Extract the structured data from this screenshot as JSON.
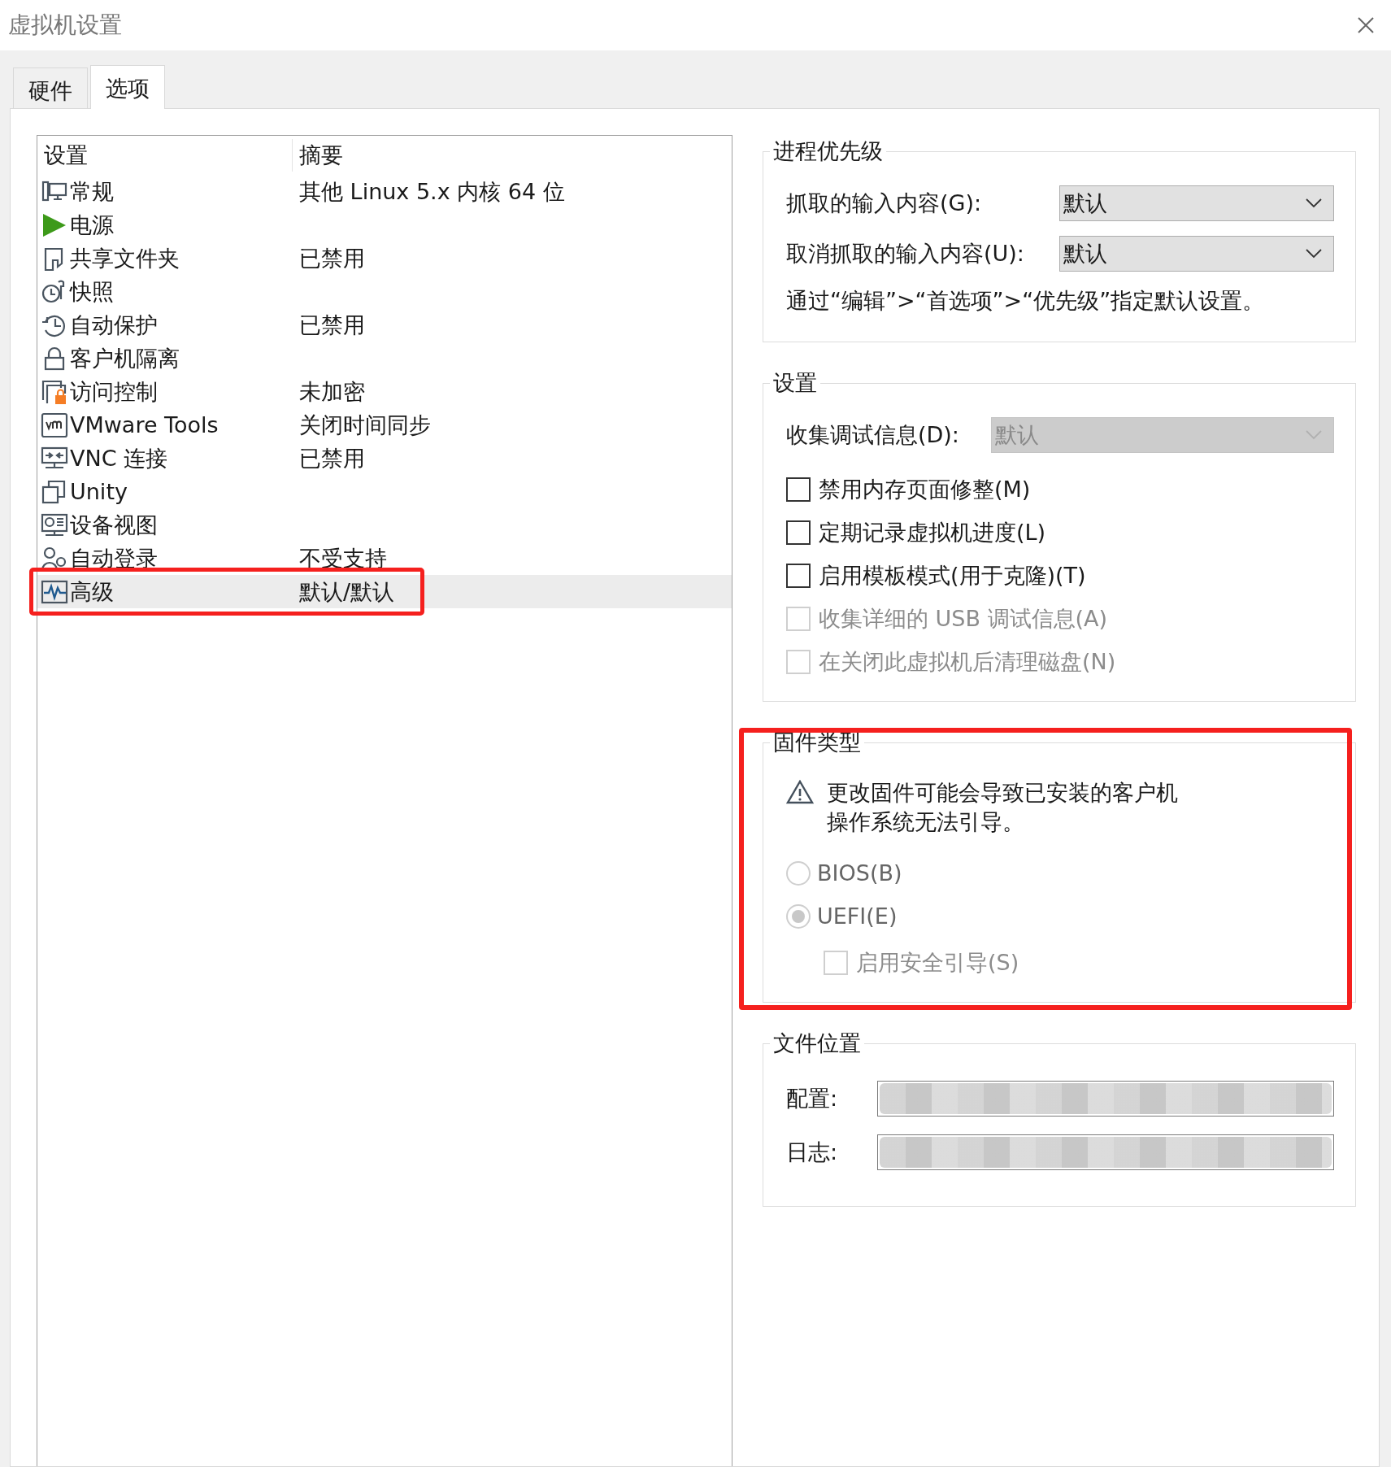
{
  "window": {
    "title": "虚拟机设置"
  },
  "tabs": [
    {
      "label": "硬件",
      "selected": false
    },
    {
      "label": "选项",
      "selected": true
    }
  ],
  "settings_list": {
    "columns": [
      "设置",
      "摘要"
    ],
    "items": [
      {
        "name": "常规",
        "summary": "其他 Linux 5.x 内核 64 位",
        "selected": false,
        "highlighted": false
      },
      {
        "name": "电源",
        "selected": false,
        "highlighted": false
      },
      {
        "name": "共享文件夹",
        "summary": "已禁用",
        "selected": false,
        "highlighted": false
      },
      {
        "name": "快照",
        "selected": false,
        "highlighted": false
      },
      {
        "name": "自动保护",
        "summary": "已禁用",
        "selected": false,
        "highlighted": false
      },
      {
        "name": "客户机隔离",
        "selected": false,
        "highlighted": false
      },
      {
        "name": "访问控制",
        "summary": "未加密",
        "selected": false,
        "highlighted": false
      },
      {
        "name": "VMware Tools",
        "summary": "关闭时间同步",
        "selected": false,
        "highlighted": false
      },
      {
        "name": "VNC 连接",
        "summary": "已禁用",
        "selected": false,
        "highlighted": false
      },
      {
        "name": "Unity",
        "selected": false,
        "highlighted": false
      },
      {
        "name": "设备视图",
        "selected": false,
        "highlighted": false
      },
      {
        "name": "自动登录",
        "summary": "不受支持",
        "selected": false,
        "highlighted": false
      },
      {
        "name": "高级",
        "summary": "默认/默认",
        "selected": true,
        "highlighted": true
      }
    ]
  },
  "priority": {
    "title": "进程优先级",
    "fields": [
      {
        "label": "抓取的输入内容(G):",
        "value": "默认",
        "disabled": false
      },
      {
        "label": "取消抓取的输入内容(U):",
        "value": "默认",
        "disabled": false
      }
    ],
    "note": "通过“编辑”>“首选项”>“优先级”指定默认设置。"
  },
  "settings": {
    "title": "设置",
    "field": {
      "label": "收集调试信息(D):",
      "value": "默认",
      "disabled": true
    },
    "checkboxes": [
      {
        "label": "禁用内存页面修整(M)",
        "checked": false,
        "disabled": false
      },
      {
        "label": "定期记录虚拟机进度(L)",
        "checked": false,
        "disabled": false
      },
      {
        "label": "启用模板模式(用于克隆)(T)",
        "checked": false,
        "disabled": false
      },
      {
        "label": "收集详细的 USB 调试信息(A)",
        "checked": false,
        "disabled": true
      },
      {
        "label": "在关闭此虚拟机后清理磁盘(N)",
        "checked": false,
        "disabled": true
      }
    ]
  },
  "firmware": {
    "title": "固件类型",
    "highlighted": true,
    "warning": "更改固件可能会导致已安装的客户机操作系统无法引导。",
    "disabled": true,
    "radios": [
      {
        "label": "BIOS(B)",
        "selected": false
      },
      {
        "label": "UEFI(E)",
        "selected": true
      }
    ],
    "secure_boot": {
      "label": "启用安全引导(S)",
      "checked": false,
      "disabled": true
    }
  },
  "file_location": {
    "title": "文件位置",
    "redacted": true,
    "fields": [
      {
        "label": "配置:"
      },
      {
        "label": "日志:"
      }
    ]
  }
}
